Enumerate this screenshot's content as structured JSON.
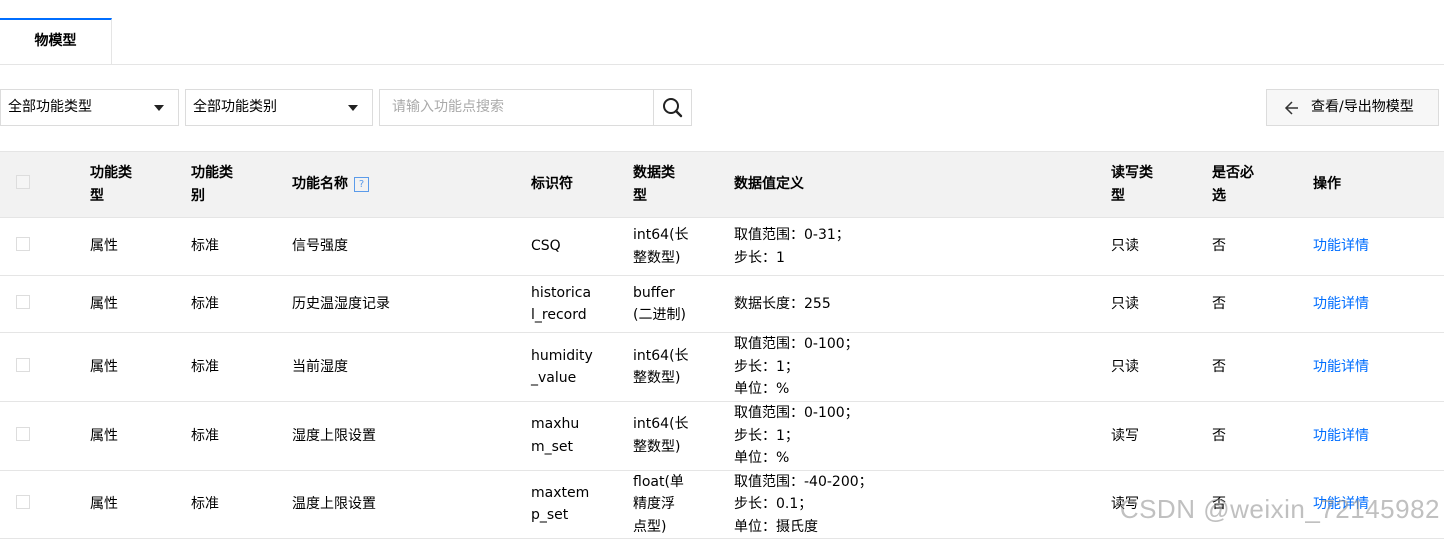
{
  "tabs": [
    {
      "label": "物模型"
    }
  ],
  "filters": {
    "type_select": "全部功能类型",
    "category_select": "全部功能类别",
    "search_placeholder": "请输入功能点搜索",
    "export_label": "查看/导出物模型"
  },
  "table": {
    "columns": [
      "功能类\n型",
      "功能类\n别",
      "功能名称",
      "标识符",
      "数据类\n型",
      "数据值定义",
      "读写类\n型",
      "是否必\n选",
      "操作"
    ],
    "rows": [
      {
        "type": "属性",
        "category": "标准",
        "name": "信号强度",
        "identifier": "CSQ",
        "data_type": "int64(长\n整数型)",
        "definition": "取值范围：0-31；\n步长：1",
        "rw": "只读",
        "required": "否",
        "action": "功能详情"
      },
      {
        "type": "属性",
        "category": "标准",
        "name": "历史温湿度记录",
        "identifier": "historica\nl_record",
        "data_type": "buffer\n(二进制)",
        "definition": "数据长度：255",
        "rw": "只读",
        "required": "否",
        "action": "功能详情"
      },
      {
        "type": "属性",
        "category": "标准",
        "name": "当前湿度",
        "identifier": "humidity\n_value",
        "data_type": "int64(长\n整数型)",
        "definition": "取值范围：0-100；\n步长：1；\n单位：%",
        "rw": "只读",
        "required": "否",
        "action": "功能详情"
      },
      {
        "type": "属性",
        "category": "标准",
        "name": "湿度上限设置",
        "identifier": "maxhu\nm_set",
        "data_type": "int64(长\n整数型)",
        "definition": "取值范围：0-100；\n步长：1；\n单位：%",
        "rw": "读写",
        "required": "否",
        "action": "功能详情"
      },
      {
        "type": "属性",
        "category": "标准",
        "name": "温度上限设置",
        "identifier": "maxtem\np_set",
        "data_type": "float(单\n精度浮\n点型)",
        "definition": "取值范围：-40-200；\n步长：0.1；\n单位：摄氏度",
        "rw": "读写",
        "required": "否",
        "action": "功能详情"
      }
    ]
  },
  "watermark": "CSDN @weixin_72145982",
  "colors": {
    "accent": "#006eff",
    "header_bg": "#f2f2f2",
    "border": "#e5e5e5"
  }
}
